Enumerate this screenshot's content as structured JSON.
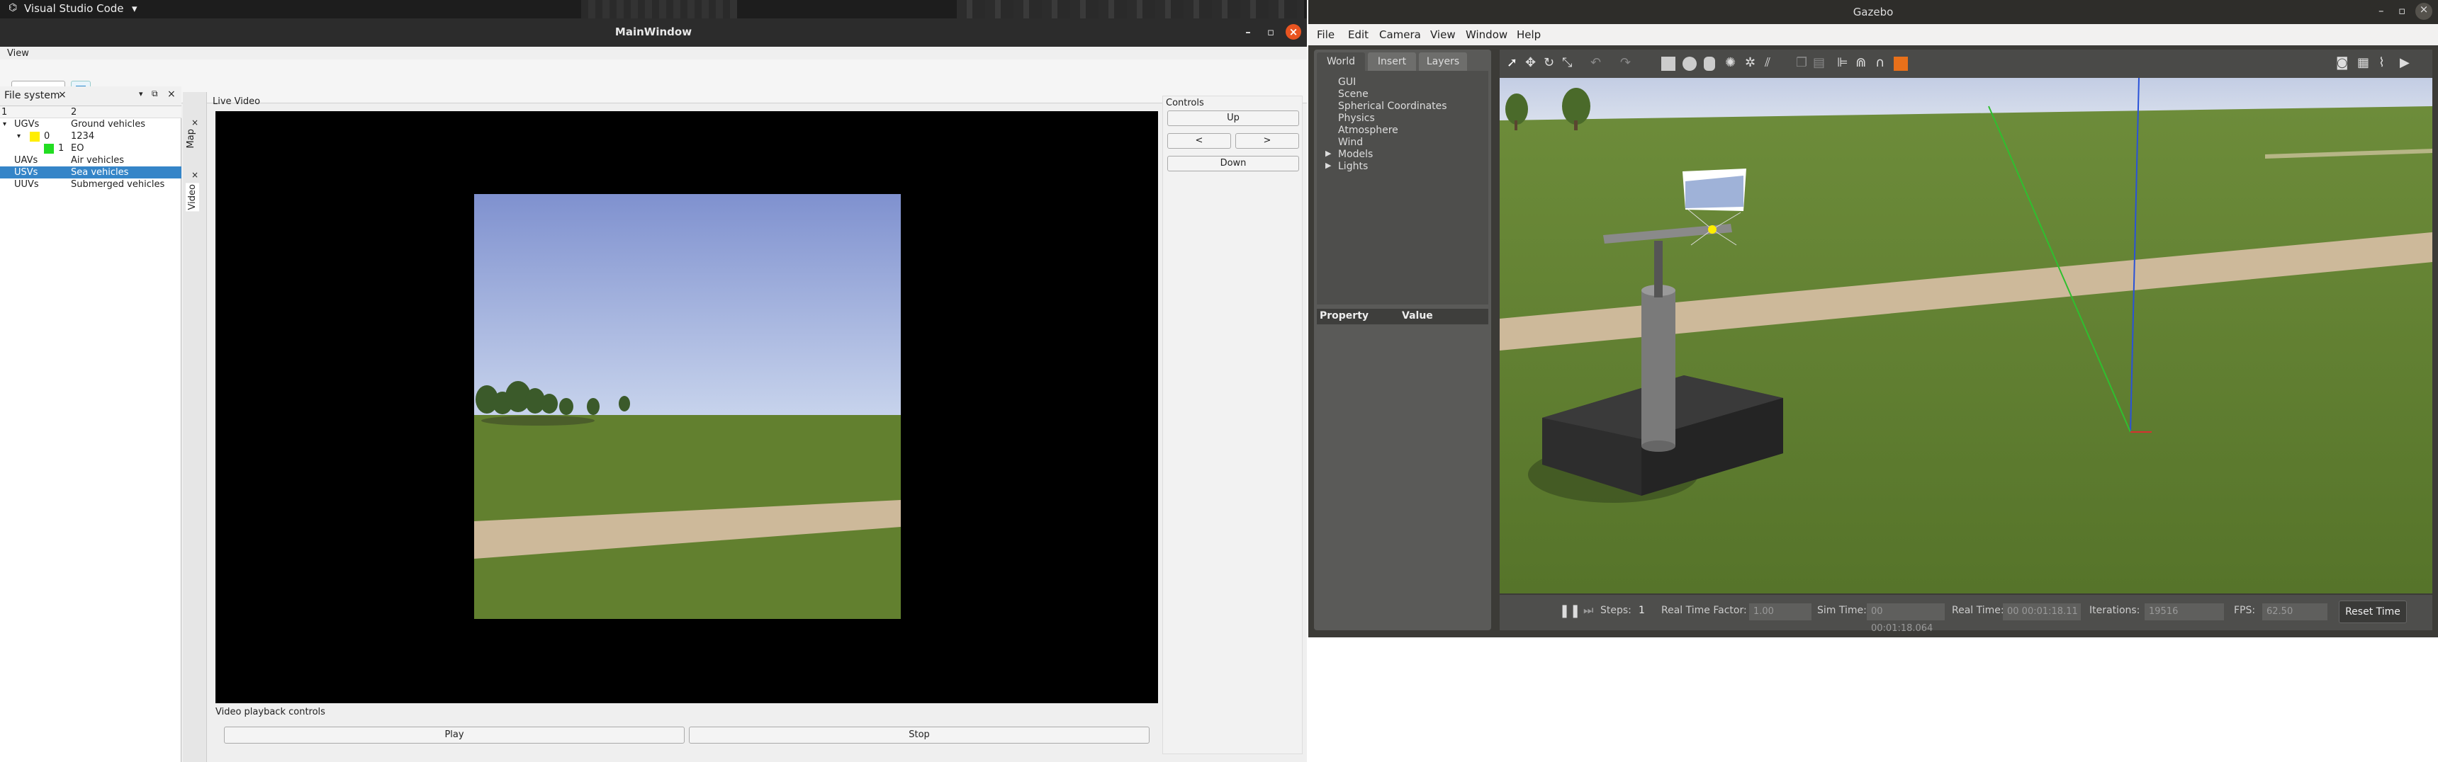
{
  "top_panel": {
    "app_name": "Visual Studio Code"
  },
  "main_window": {
    "title": "MainWindow",
    "menu_view": "View",
    "file_system_dock": {
      "title": "File system",
      "columns": [
        "1",
        "2"
      ],
      "rows": [
        {
          "c1": "UGVs",
          "c2": "Ground vehicles"
        },
        {
          "c1": "0",
          "c2": "1234"
        },
        {
          "c1": "1",
          "c2": "EO"
        },
        {
          "c1": "UAVs",
          "c2": "Air vehicles"
        },
        {
          "c1": "USVs",
          "c2": "Sea vehicles"
        },
        {
          "c1": "UUVs",
          "c2": "Submerged vehicles"
        }
      ]
    },
    "side_tabs": {
      "map": "Map",
      "video": "Video"
    },
    "live_video_label": "Live Video",
    "playback_label": "Video playback controls",
    "play_label": "Play",
    "stop_label": "Stop",
    "controls": {
      "title": "Controls",
      "up": "Up",
      "left": "<",
      "right": ">",
      "down": "Down"
    }
  },
  "gazebo": {
    "title": "Gazebo",
    "menu": [
      "File",
      "Edit",
      "Camera",
      "View",
      "Window",
      "Help"
    ],
    "tabs": [
      "World",
      "Insert",
      "Layers"
    ],
    "world_items": [
      "GUI",
      "Scene",
      "Spherical Coordinates",
      "Physics",
      "Atmosphere",
      "Wind",
      "Models",
      "Lights"
    ],
    "property_header": "Property",
    "value_header": "Value",
    "bottom": {
      "steps_label": "Steps:",
      "steps_value": "1",
      "rtf_label": "Real Time Factor:",
      "rtf_value": "1.00",
      "sim_time_label": "Sim Time:",
      "sim_time_value": "00 00:01:18.064",
      "real_time_label": "Real Time:",
      "real_time_value": "00 00:01:18.11",
      "iterations_label": "Iterations:",
      "iterations_value": "19516",
      "fps_label": "FPS:",
      "fps_value": "62.50",
      "reset_label": "Reset Time"
    }
  },
  "colors": {
    "selection": "#3585c8",
    "sky": "#8ea2d8",
    "grass": "#5e7a30",
    "path": "#cdb99a",
    "close": "#e95420",
    "yellow_marker": "#ffee00",
    "green_marker": "#22dd22"
  }
}
